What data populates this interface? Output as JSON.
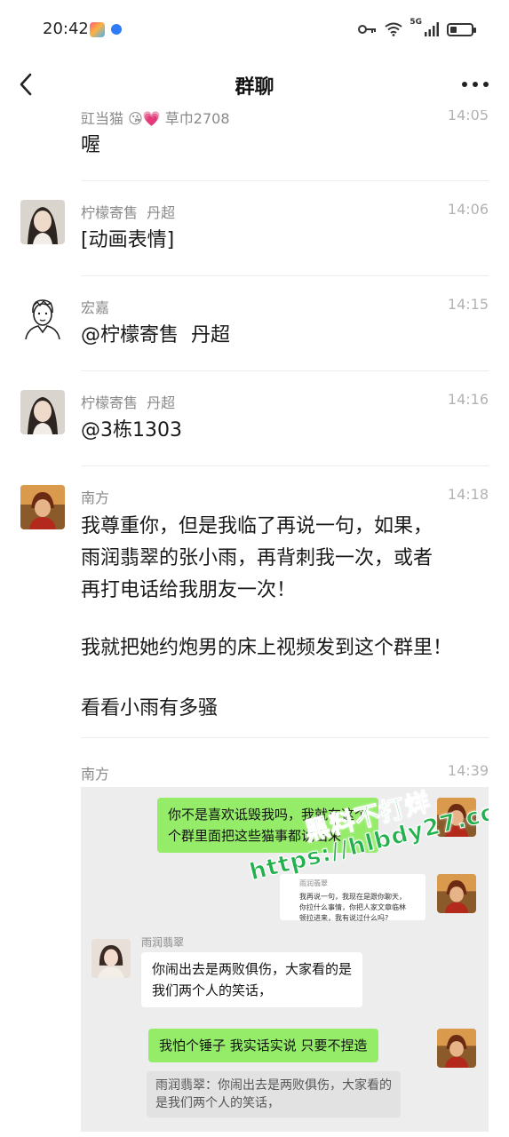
{
  "status_bar": {
    "time": "20:42",
    "network": "5G"
  },
  "header": {
    "title": "群聊"
  },
  "partial_message": {
    "sender": "豇当猫 😘💗 草巾2708",
    "time": "14:05",
    "text": "喔"
  },
  "messages": [
    {
      "sender": "柠檬寄售  丹超",
      "time": "14:06",
      "lines": [
        "[动画表情]"
      ]
    },
    {
      "sender": "宏嘉",
      "time": "14:15",
      "lines": [
        "@柠檬寄售  丹超"
      ]
    },
    {
      "sender": "柠檬寄售  丹超",
      "time": "14:16",
      "lines": [
        "@3栋1303"
      ]
    },
    {
      "sender": "南方",
      "time": "14:18",
      "lines": [
        "我尊重你，但是我临了再说一句，如果，",
        "雨润翡翠的张小雨，再背刺我一次，或者",
        "再打电话给我朋友一次！",
        "",
        "我就把她约炮男的床上视频发到这个群里！",
        "",
        "看看小雨有多骚"
      ]
    },
    {
      "sender": "南方",
      "time": "14:39"
    }
  ],
  "screenshot": {
    "bubble1": "你不是喜欢诋毁我吗，我就在这个\n个群里面把这些猫事都说出来",
    "forward_name": "雨润翡翠",
    "forward_text": "我再说一句，我现在是跟你聊天，\n你拉什么事情，你把人家文章临林\n顿拉进来，我有说过什么吗?",
    "other_name": "雨润翡翠",
    "bubble2": "你闹出去是两败俱伤，大家看的是\n我们两个人的笑话，",
    "bubble3": "我怕个锤子 我实话实说 只要不捏造",
    "quote": "雨润翡翠：你闹出去是两败俱伤，大家看的\n是我们两个人的笑话，",
    "watermark1": "黑料不打烊",
    "watermark2": "https://hlbdy27.com"
  },
  "colors": {
    "green_bubble": "#95ec69",
    "chat_bg": "#ffffff",
    "screenshot_bg": "#ededed"
  }
}
